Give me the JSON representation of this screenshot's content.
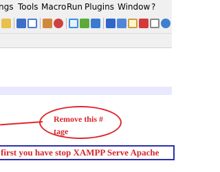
{
  "menubar": {
    "items": [
      "ngs",
      "Tools",
      "Macro",
      "Run",
      "Plugins",
      "Window",
      "?"
    ]
  },
  "annotation": {
    "callout_text": "Remove this #\ntage",
    "notice_text": "first you have stop XAMPP Serve Apache"
  }
}
